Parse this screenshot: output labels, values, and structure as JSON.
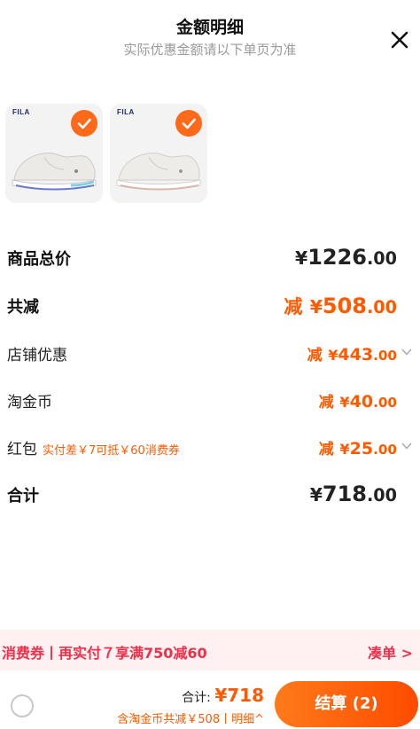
{
  "header": {
    "title": "金额明细",
    "subtitle": "实际优惠金额请以下单页为准"
  },
  "products": [
    {
      "brand": "FILA",
      "selected": true
    },
    {
      "brand": "FILA",
      "selected": true
    }
  ],
  "breakdown": {
    "goods_total": {
      "label": "商品总价",
      "currency": "¥",
      "int": "1226",
      "dec": ".00"
    },
    "total_reduce": {
      "label": "共减",
      "prefix": "减",
      "currency": "¥",
      "int": "508",
      "dec": ".00"
    },
    "store_discount": {
      "label": "店铺优惠",
      "prefix": "减",
      "currency": "¥",
      "int": "443",
      "dec": ".00"
    },
    "taojinbi": {
      "label": "淘金币",
      "prefix": "减",
      "currency": "¥",
      "int": "40",
      "dec": ".00"
    },
    "red_packet": {
      "label": "红包",
      "note": "实付差￥7可抵￥60消费券",
      "prefix": "减",
      "currency": "¥",
      "int": "25",
      "dec": ".00"
    },
    "sum": {
      "label": "合计",
      "currency": "¥",
      "int": "718",
      "dec": ".00"
    }
  },
  "promo": {
    "text": "消费券丨再实付７享满750减60",
    "link": "凑单 >"
  },
  "footer": {
    "total_label": "合计: ",
    "total_value": "¥718",
    "sub_text": "含淘金币共减￥508丨明细^",
    "pay_button": "结算 (2)"
  },
  "colors": {
    "accent": "#ff5a00",
    "promo_bg": "#fff0f1",
    "promo_text": "#f0304a"
  }
}
